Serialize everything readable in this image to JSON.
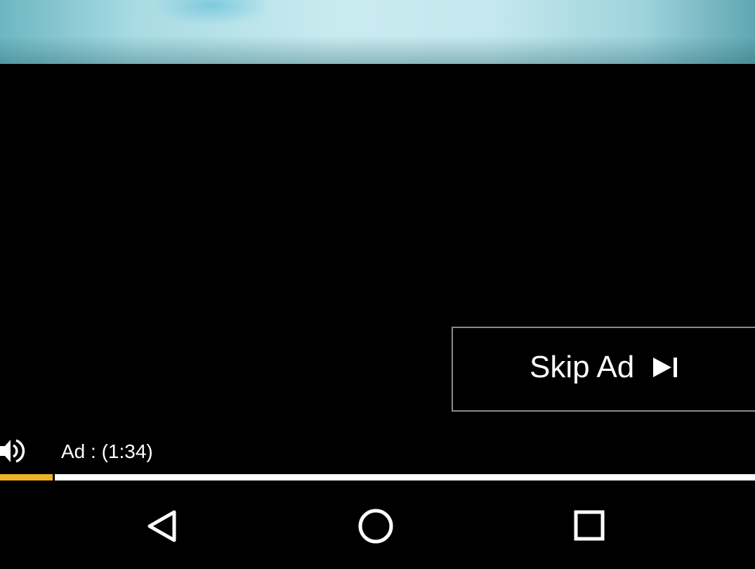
{
  "ad": {
    "skip_label": "Skip Ad",
    "timer_text": "Ad : (1:34)",
    "progress_fraction": 0.07
  },
  "icons": {
    "volume": "volume-icon",
    "skip": "skip-next-icon",
    "back": "back-triangle-icon",
    "home": "home-circle-icon",
    "recents": "recents-square-icon"
  },
  "colors": {
    "progress_played": "#f0b323",
    "progress_track": "#ffffff",
    "background": "#000000",
    "skip_border": "#8a8a8a"
  }
}
